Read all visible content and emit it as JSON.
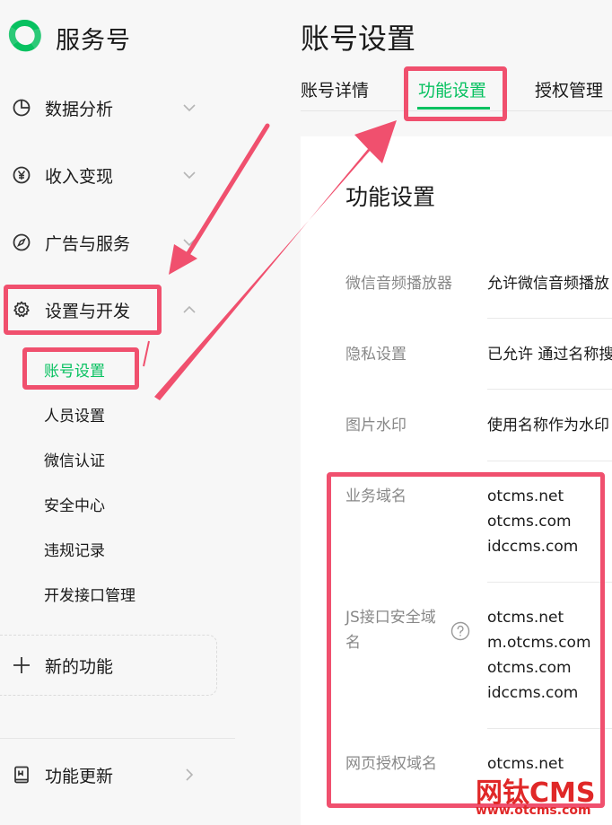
{
  "brand": {
    "name": "服务号",
    "logo_icon": "wechat-service-logo"
  },
  "sidebar": {
    "items": [
      {
        "label": "数据分析",
        "icon": "pie-chart-icon",
        "chevron": "chevron-down"
      },
      {
        "label": "收入变现",
        "icon": "yen-circle-icon",
        "chevron": "chevron-down"
      },
      {
        "label": "广告与服务",
        "icon": "compass-icon",
        "chevron": "chevron-down"
      },
      {
        "label": "设置与开发",
        "icon": "gear-icon",
        "chevron": "chevron-up"
      }
    ],
    "subitems": [
      {
        "label": "账号设置",
        "active": true
      },
      {
        "label": "人员设置"
      },
      {
        "label": "微信认证"
      },
      {
        "label": "安全中心"
      },
      {
        "label": "违规记录"
      },
      {
        "label": "开发接口管理"
      }
    ],
    "new_feature": {
      "label": "新的功能",
      "icon": "plus-icon"
    },
    "bottom_item": {
      "label": "功能更新",
      "icon": "book-icon"
    }
  },
  "main": {
    "title": "账号设置",
    "tabs": [
      {
        "label": "账号详情"
      },
      {
        "label": "功能设置",
        "active": true
      },
      {
        "label": "授权管理"
      }
    ],
    "card": {
      "title": "功能设置",
      "rows": [
        {
          "label": "微信音频播放器",
          "value": "允许微信音频播放"
        },
        {
          "label": "隐私设置",
          "value": "已允许 通过名称搜"
        },
        {
          "label": "图片水印",
          "value": "使用名称作为水印"
        },
        {
          "label": "业务域名",
          "values": [
            "otcms.net",
            "otcms.com",
            "idccms.com"
          ]
        },
        {
          "label": "JS接口安全域名",
          "label_lines": [
            "JS接口安全域",
            "名"
          ],
          "values": [
            "otcms.net",
            "m.otcms.com",
            "otcms.com",
            "idccms.com"
          ],
          "help_icon": "question-circle-icon"
        },
        {
          "label": "网页授权域名",
          "values": [
            "otcms.net"
          ]
        }
      ]
    }
  },
  "watermark": {
    "brand": "网钛CMS",
    "url": "www.otcms.com"
  },
  "colors": {
    "accent": "#07c160",
    "annotation": "#f0506e",
    "sidebar_bg": "#f7f7f7",
    "watermark": "#e02828"
  }
}
